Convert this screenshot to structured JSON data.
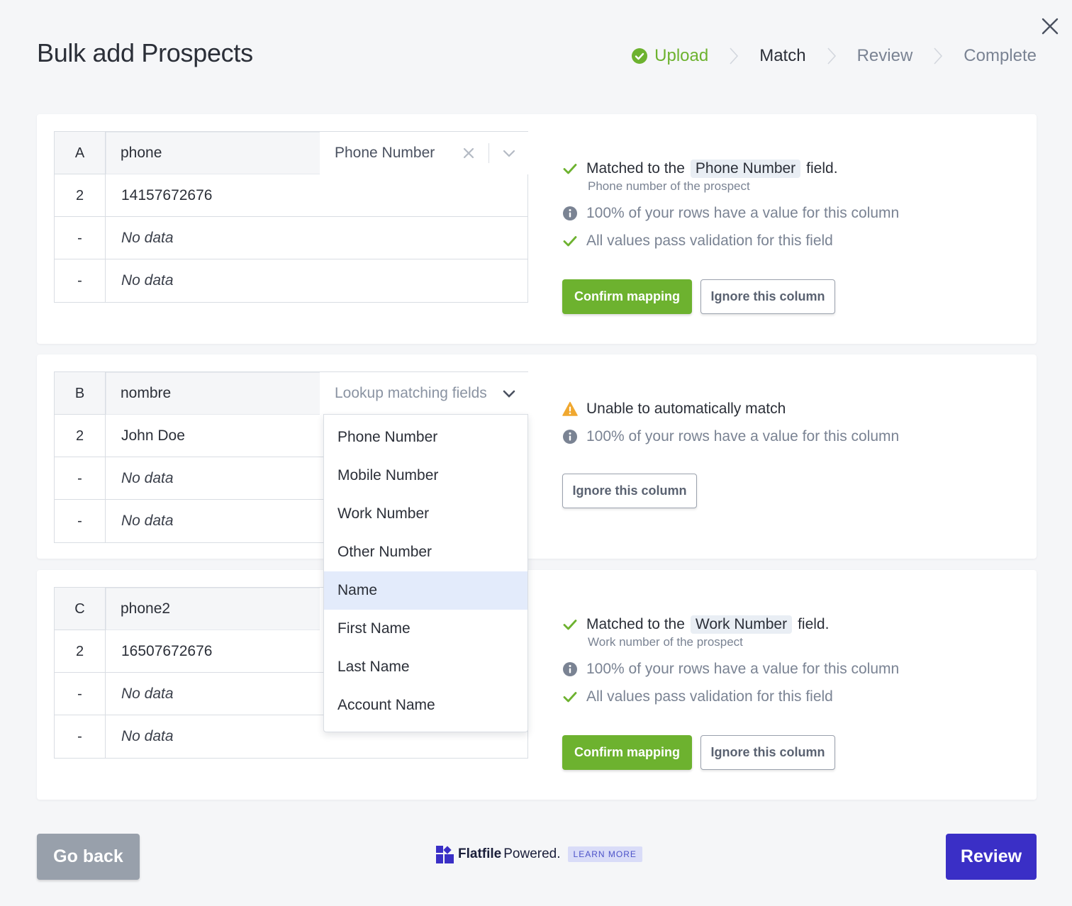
{
  "header": {
    "title": "Bulk add Prospects",
    "steps": [
      {
        "label": "Upload",
        "state": "done"
      },
      {
        "label": "Match",
        "state": "active"
      },
      {
        "label": "Review",
        "state": "pending"
      },
      {
        "label": "Complete",
        "state": "pending"
      }
    ]
  },
  "columns": [
    {
      "letter": "A",
      "name": "phone",
      "mapping": "Phone Number",
      "rows": [
        {
          "idx": "2",
          "value": "14157672676"
        },
        {
          "idx": "-",
          "value": "No data"
        },
        {
          "idx": "-",
          "value": "No data"
        }
      ],
      "status": "Matched to the",
      "field": "Phone Number",
      "status_suffix": "field.",
      "field_desc": "Phone number of the prospect",
      "coverage": "100% of your rows have a value for this column",
      "validation": "All values pass validation for this field",
      "confirm_label": "Confirm mapping",
      "ignore_label": "Ignore this column"
    },
    {
      "letter": "B",
      "name": "nombre",
      "mapping_placeholder": "Lookup matching fields",
      "rows": [
        {
          "idx": "2",
          "value": "John Doe"
        },
        {
          "idx": "-",
          "value": "No data"
        },
        {
          "idx": "-",
          "value": "No data"
        }
      ],
      "status": "Unable to automatically match",
      "coverage": "100% of your rows have a value for this column",
      "ignore_label": "Ignore this column"
    },
    {
      "letter": "C",
      "name": "phone2",
      "rows": [
        {
          "idx": "2",
          "value": "16507672676"
        },
        {
          "idx": "-",
          "value": "No data"
        },
        {
          "idx": "-",
          "value": "No data"
        }
      ],
      "status": "Matched to the",
      "field": "Work Number",
      "status_suffix": "field.",
      "field_desc": "Work number of the prospect",
      "coverage": "100% of your rows have a value for this column",
      "validation": "All values pass validation for this field",
      "confirm_label": "Confirm mapping",
      "ignore_label": "Ignore this column"
    }
  ],
  "dropdown": {
    "options": [
      "Phone Number",
      "Mobile Number",
      "Work Number",
      "Other Number",
      "Name",
      "First Name",
      "Last Name",
      "Account Name"
    ],
    "highlighted": "Name"
  },
  "footer": {
    "back_label": "Go back",
    "brand": "Flatfile",
    "powered": "Powered.",
    "learn_more": "LEARN MORE",
    "review_label": "Review"
  },
  "colors": {
    "green": "#6db22f",
    "warning": "#f0a830",
    "primary": "#3a2fc6",
    "info": "#7a8393"
  },
  "icons": {
    "close": "close-icon",
    "check_circle": "check-circle-icon",
    "chevron_right": "chevron-right-icon",
    "check": "check-icon",
    "info": "info-icon",
    "warning": "warning-icon",
    "chevron_down": "chevron-down-icon",
    "clear": "clear-icon"
  }
}
